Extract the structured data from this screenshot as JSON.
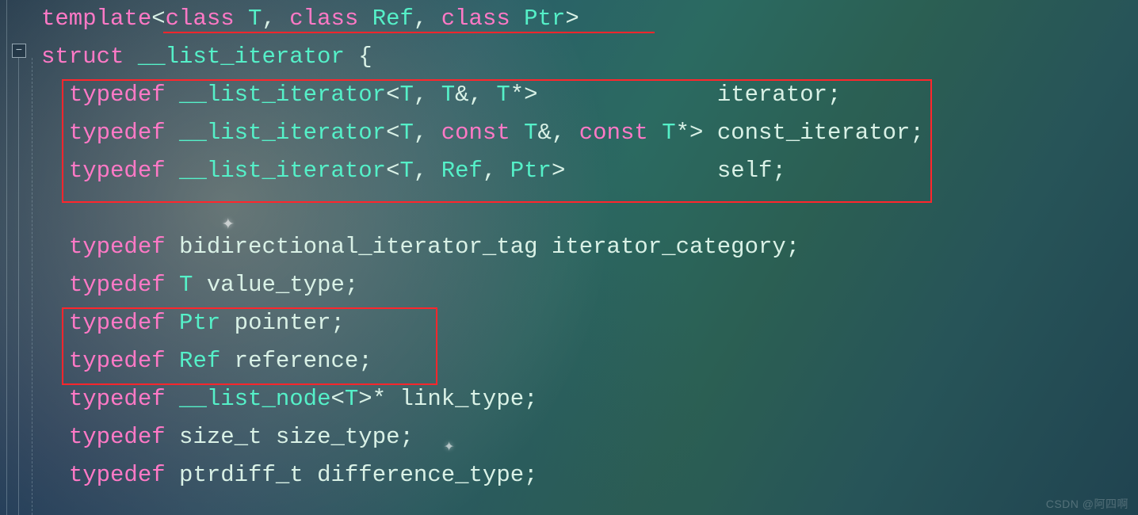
{
  "code": {
    "l1": {
      "template": "template",
      "lt": "<",
      "class1": "class",
      "T": " T",
      "comma1": ",",
      "class2": " class",
      "Ref": " Ref",
      "comma2": ",",
      "class3": " class",
      "Ptr": " Ptr",
      "gt": ">"
    },
    "l2": {
      "struct": "struct",
      "name": " __list_iterator ",
      "brace": "{"
    },
    "l3": {
      "indent": "  ",
      "typedef": "typedef",
      "sp1": " ",
      "id": "__list_iterator",
      "lt": "<",
      "T1": "T",
      "c1": ",",
      "sp2": " ",
      "T2": "T",
      "amp": "&",
      "c2": ",",
      "sp3": " ",
      "T3": "T",
      "star": "*",
      "gt": ">",
      "pad": "             ",
      "alias": "iterator",
      "semi": ";"
    },
    "l4": {
      "indent": "  ",
      "typedef": "typedef",
      "sp1": " ",
      "id": "__list_iterator",
      "lt": "<",
      "T1": "T",
      "c1": ",",
      "sp2": " ",
      "const1": "const",
      "sp3": " ",
      "T2": "T",
      "amp": "&",
      "c2": ",",
      "sp4": " ",
      "const2": "const",
      "sp5": " ",
      "T3": "T",
      "star": "*",
      "gt": ">",
      "sp6": " ",
      "alias": "const_iterator",
      "semi": ";"
    },
    "l5": {
      "indent": "  ",
      "typedef": "typedef",
      "sp1": " ",
      "id": "__list_iterator",
      "lt": "<",
      "T1": "T",
      "c1": ",",
      "sp2": " ",
      "Ref": "Ref",
      "c2": ",",
      "sp3": " ",
      "Ptr": "Ptr",
      "gt": ">",
      "pad": "           ",
      "alias": "self",
      "semi": ";"
    },
    "l7": {
      "indent": "  ",
      "typedef": "typedef",
      "sp1": " ",
      "id1": "bidirectional_iterator_tag",
      "sp2": " ",
      "id2": "iterator_category",
      "semi": ";"
    },
    "l8": {
      "indent": "  ",
      "typedef": "typedef",
      "sp1": " ",
      "T": "T",
      "sp2": " ",
      "alias": "value_type",
      "semi": ";"
    },
    "l9": {
      "indent": "  ",
      "typedef": "typedef",
      "sp1": " ",
      "Ptr": "Ptr",
      "sp2": " ",
      "alias": "pointer",
      "semi": ";"
    },
    "l10": {
      "indent": "  ",
      "typedef": "typedef",
      "sp1": " ",
      "Ref": "Ref",
      "sp2": " ",
      "alias": "reference",
      "semi": ";"
    },
    "l11": {
      "indent": "  ",
      "typedef": "typedef",
      "sp1": " ",
      "id": "__list_node",
      "lt": "<",
      "T": "T",
      "gt": ">",
      "star": "*",
      "sp2": " ",
      "alias": "link_type",
      "semi": ";"
    },
    "l12": {
      "indent": "  ",
      "typedef": "typedef",
      "sp1": " ",
      "id": "size_t",
      "sp2": " ",
      "alias": "size_type",
      "semi": ";"
    },
    "l13": {
      "indent": "  ",
      "typedef": "typedef",
      "sp1": " ",
      "id": "ptrdiff_t",
      "sp2": " ",
      "alias": "difference_type",
      "semi": ";"
    }
  },
  "fold_symbol": "−",
  "watermark": "CSDN @阿四啊"
}
